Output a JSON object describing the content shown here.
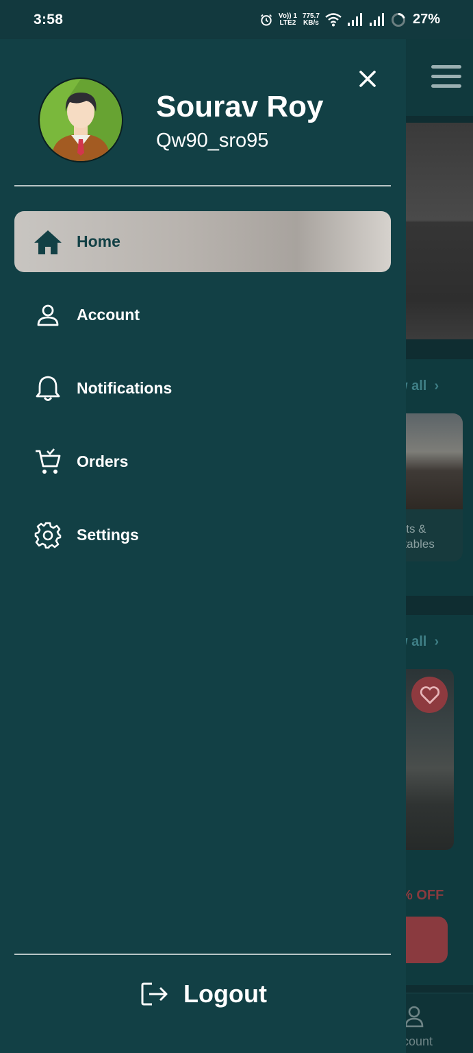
{
  "status_bar": {
    "time": "3:58",
    "network_top": "Vo)) 1",
    "network_bottom": "LTE2",
    "speed_value": "775.7",
    "speed_unit": "KB/s",
    "battery": "27%",
    "icons": [
      "alarm-icon",
      "wifi-icon",
      "signal-icon",
      "signal-icon",
      "battery-ring-icon"
    ]
  },
  "drawer": {
    "user": {
      "name": "Sourav Roy",
      "handle": "Qw90_sro95",
      "avatar_icon": "avatar-man-icon"
    },
    "close_icon": "close-icon",
    "menu": [
      {
        "label": "Home",
        "icon": "home-icon",
        "active": true
      },
      {
        "label": "Account",
        "icon": "person-icon",
        "active": false
      },
      {
        "label": "Notifications",
        "icon": "bell-icon",
        "active": false
      },
      {
        "label": "Orders",
        "icon": "cart-icon",
        "active": false
      },
      {
        "label": "Settings",
        "icon": "gear-icon",
        "active": false
      }
    ],
    "logout": {
      "label": "Logout",
      "icon": "logout-icon"
    }
  },
  "background_app": {
    "view_all_1": "w all",
    "view_all_2": "w all",
    "card_text_line1": "uits &",
    "card_text_line2": "etables",
    "discount": "% OFF",
    "bottom_nav_label": "count"
  },
  "colors": {
    "drawer_bg": "#124045",
    "status_bar_bg": "#12393e",
    "active_item_bg": "#c8c5c1",
    "accent_red": "#8e3a3f"
  }
}
